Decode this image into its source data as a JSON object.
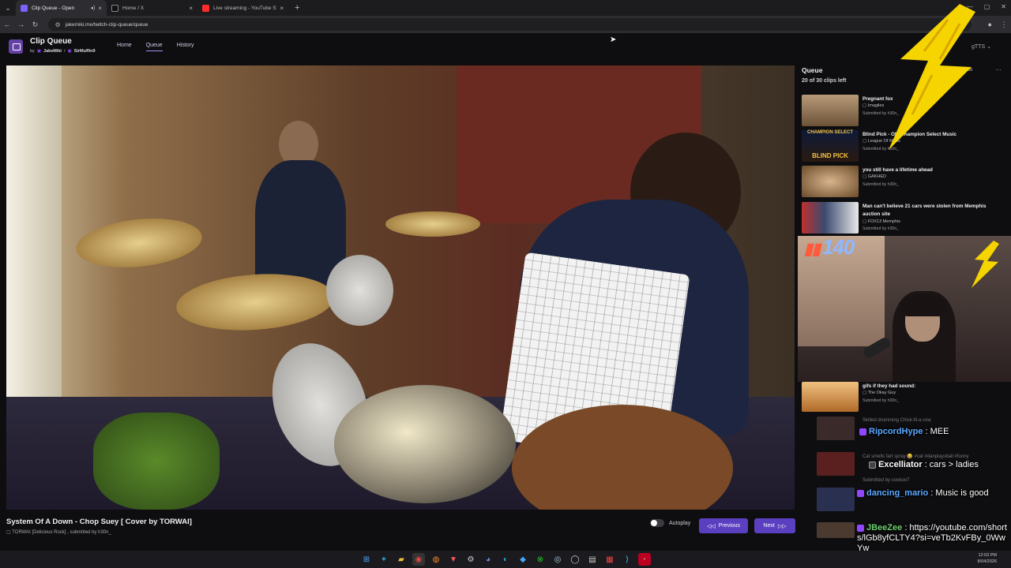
{
  "browser": {
    "tabs": [
      {
        "title": "Clip Queue - Open",
        "active": true,
        "color": "#7b61ff"
      },
      {
        "title": "Home / X",
        "active": false,
        "color": "#111111"
      },
      {
        "title": "Live streaming - YouTube Studi",
        "active": false,
        "color": "#ff2b2b"
      }
    ],
    "new_tab": "+",
    "url": "jakemiki.me/twitch-clip-queue/queue"
  },
  "app": {
    "title": "Clip Queue",
    "by": "by",
    "author1": "JakeMiki",
    "sep": "/",
    "author2": "SirMuffin9",
    "nav": {
      "home": "Home",
      "queue": "Queue",
      "history": "History"
    },
    "tts": "gTTS"
  },
  "player": {
    "title": "System Of A Down - Chop Suey [ Cover by TORWAI]",
    "subtitle": "TORWAI [Delicious Rock] , submitted by h30n_",
    "autoplay_label": "Autoplay",
    "prev_label": "Previous",
    "next_label": "Next"
  },
  "queue": {
    "heading": "Queue",
    "count": "20 of 30 clips left",
    "open_label": "Open",
    "more": "···",
    "items": [
      {
        "title": "Pregnant fox",
        "channel": "Imagiles",
        "by": "Submitted by h30n_",
        "thumb": "#8b6a4a"
      },
      {
        "title": "Blind Pick - Old Champion Select Music",
        "channel": "League Of Music",
        "by": "Submitted by h30n_",
        "thumb": "#1d2a5a"
      },
      {
        "title": "you still have a lifetime ahead",
        "channel": "GAKHED",
        "by": "Submitted by h30n_",
        "thumb": "#a0784e"
      },
      {
        "title": "Man can't believe 21 cars were stolen from Memphis auction site",
        "channel": "FOX13 Memphis",
        "by": "Submitted by h30n_",
        "thumb": "#3b4a6e"
      },
      {
        "title": "gifs if they had sound:",
        "channel": "The Okay Guy",
        "by": "Submitted by h30n_",
        "thumb": "#c8823a"
      }
    ],
    "ghost_items": [
      "Skilled drumming Chick-fil-a cow",
      "Cat smells fart spray 😂 #cat #danplaysitall #funny",
      "Submitted by cookoo7"
    ]
  },
  "stream_overlay": {
    "counter": "140",
    "chat": [
      {
        "user": "RipcordHype",
        "text": " : MEE",
        "color": "#5aa9ff"
      },
      {
        "user": "Excelliator",
        "text": " : cars > ladies",
        "color": "#ffffff"
      },
      {
        "user": "dancing_mario",
        "text": " : Music is good",
        "color": "#5aa9ff"
      },
      {
        "user": "JBeeZee",
        "text": " : https://youtube.com/shorts/lGb8yfCLTY4?si=veTb2KvFBy_0WwYw",
        "color": "#6dd06d"
      }
    ]
  },
  "taskbar": {
    "clock_time": "12:03 PM",
    "clock_date": "8/04/2026"
  },
  "colors": {
    "accent": "#5a3fc0",
    "bolt": "#f5d400"
  }
}
